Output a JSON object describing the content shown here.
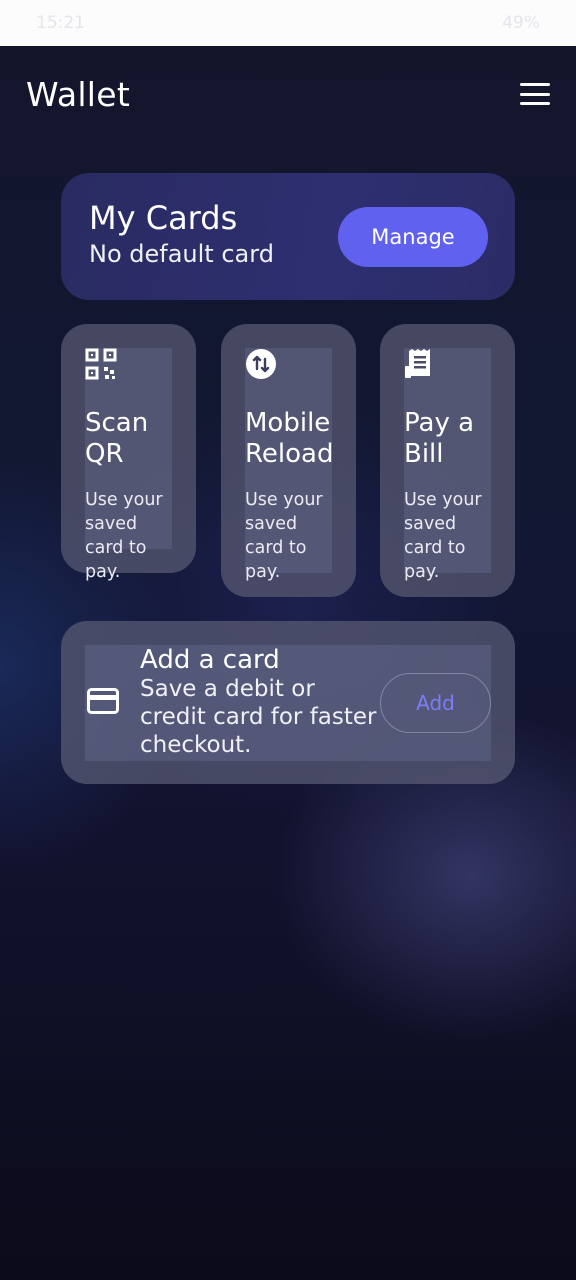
{
  "status_bar": {
    "time": "15:21",
    "battery": "49%"
  },
  "header": {
    "title": "Wallet",
    "menu_icon": "hamburger-menu-icon"
  },
  "my_cards": {
    "title": "My Cards",
    "subtitle": "No default card",
    "manage_label": "Manage"
  },
  "tiles": [
    {
      "icon": "qr-code-icon",
      "title": "Scan QR",
      "description": "Use your saved card to pay."
    },
    {
      "icon": "mobile-reload-icon",
      "title": "Mobile Reload",
      "description": "Use your saved card to pay."
    },
    {
      "icon": "receipt-icon",
      "title": "Pay a Bill",
      "description": "Use your saved card to pay."
    }
  ],
  "add_card": {
    "icon": "credit-card-icon",
    "title": "Add a card",
    "subtitle": "Save a debit or credit card for faster checkout.",
    "add_label": "Add"
  },
  "colors": {
    "accent": "#6161f0",
    "add_text": "#7b7ef5",
    "background": "#12152e"
  }
}
